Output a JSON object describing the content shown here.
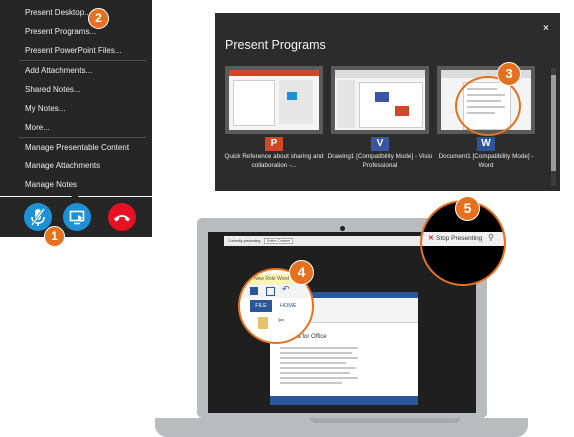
{
  "menu": {
    "items": [
      {
        "label": "Present Desktop..."
      },
      {
        "label": "Present Programs..."
      },
      {
        "label": "Present PowerPoint Files..."
      },
      {
        "label": "Add Attachments..."
      },
      {
        "label": "Shared Notes..."
      },
      {
        "label": "My Notes..."
      },
      {
        "label": "More..."
      },
      {
        "label": "Manage Presentable Content"
      },
      {
        "label": "Manage Attachments"
      },
      {
        "label": "Manage Notes"
      }
    ]
  },
  "call_controls": {
    "mute": {
      "icon": "mic-muted-icon"
    },
    "present": {
      "icon": "present-screen-icon"
    },
    "hangup": {
      "icon": "hang-up-icon"
    }
  },
  "dialog": {
    "title": "Present Programs",
    "close": "×",
    "programs": [
      {
        "app": "P",
        "app_icon": "powerpoint-icon",
        "color": "#d24726",
        "caption": "Quick Reference about sharing and collaboration -..."
      },
      {
        "app": "V",
        "app_icon": "visio-icon",
        "color": "#3955a3",
        "caption": "Drawing1  [Compatibility Mode] - Visio Professional"
      },
      {
        "app": "W",
        "app_icon": "word-icon",
        "color": "#2b579a",
        "caption": "Document1 [Compatibility Mode] - Word"
      }
    ]
  },
  "laptop": {
    "presenting_bar": {
      "label": "Currently presenting",
      "selector": "Entire Content"
    },
    "stop_presenting": "Stop Presenting",
    "word_window": {
      "title": "New Role Word",
      "tab_file": "FILE",
      "tab_home": "HOME",
      "doc_heading": "Agenda for Office"
    }
  },
  "badges": [
    "1",
    "2",
    "3",
    "4",
    "5"
  ],
  "colors": {
    "accent": "#e5701e",
    "menu_bg": "#262626",
    "dialog_bg": "#2c2c2c",
    "present_blue": "#1e90d6",
    "hangup_red": "#e81123"
  }
}
